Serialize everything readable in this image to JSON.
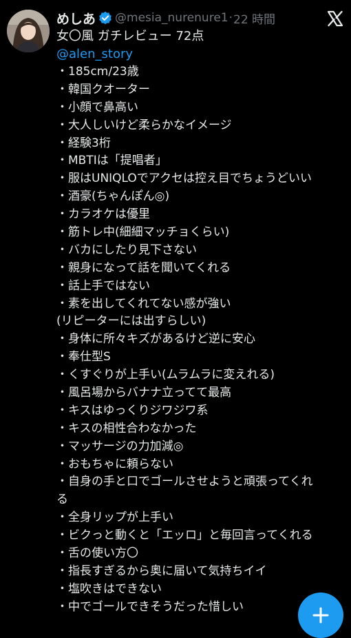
{
  "author": {
    "display_name": "めしあ",
    "handle": "@mesia_nurenure1",
    "separator": "·",
    "time": "22 時間",
    "avatar_icon": "profile-photo",
    "verified_icon": "verified-badge-icon"
  },
  "tweet": {
    "headline": "女〇風 ガチレビュー 72点",
    "mention": "@alen_story",
    "lines": [
      "・185cm/23歳",
      "・韓国クオーター",
      "・小顔で鼻高い",
      "・大人しいけど柔らかなイメージ",
      "・経験3桁",
      "・MBTIは「提唱者」",
      "・服はUNIQLOでアクセは控え目でちょうどいい",
      "・酒豪(ちゃんぽん◎)",
      "・カラオケは優里",
      "・筋トレ中(細細マッチョくらい)",
      "・バカにしたり見下さない",
      "・親身になって話を聞いてくれる",
      "・話上手ではない",
      "・素を出してくれてない感が強い",
      "(リピーターには出すらしい)",
      "・身体に所々キズがあるけど逆に安心",
      "・奉仕型S",
      "・くすぐりが上手い(ムラムラに変えれる)",
      "・風呂場からバナナ立ってて最高",
      "・キスはゆっくりジワジワ系",
      "・キスの相性合わなかった",
      "・マッサージの力加減◎",
      "・おもちゃに頼らない",
      "・自身の手と口でゴールさせようと頑張ってくれ",
      "る",
      "・全身リップが上手い",
      "・ビクっと動くと「エッロ」と毎回言ってくれる",
      "・舌の使い方〇",
      "・指長すぎるから奥に届いて気持ちイイ",
      "・塩吹きはできない",
      "・中でゴールできそうだった惜しい"
    ]
  },
  "icons": {
    "app_logo": "x-logo-icon",
    "compose": "plus-icon"
  },
  "colors": {
    "background": "#000000",
    "text": "#e7e9ea",
    "secondary": "#71767b",
    "accent": "#1d9bf0"
  }
}
